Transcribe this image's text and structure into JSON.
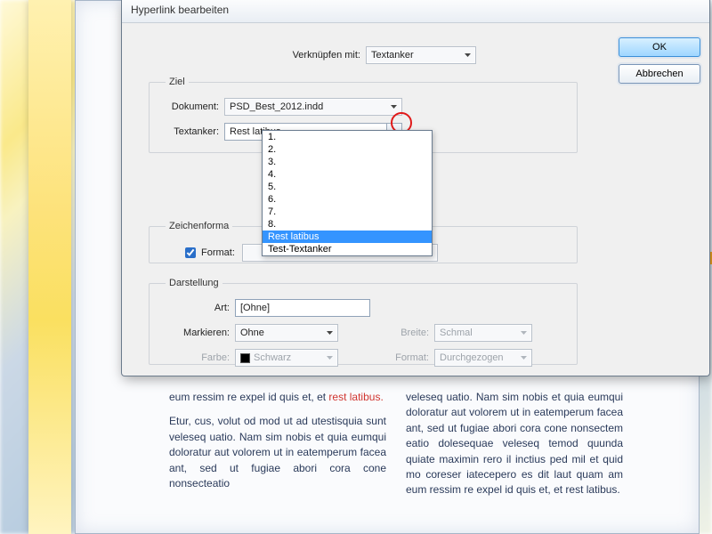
{
  "dialog": {
    "title": "Hyperlink bearbeiten",
    "link_with_label": "Verknüpfen mit:",
    "link_with_value": "Textanker",
    "ok": "OK",
    "cancel": "Abbrechen"
  },
  "ziel": {
    "legend": "Ziel",
    "document_label": "Dokument:",
    "document_value": "PSD_Best_2012.indd",
    "anchor_label": "Textanker:",
    "anchor_value": "Rest latibus",
    "options": [
      "1.",
      "2.",
      "3.",
      "4.",
      "5.",
      "6.",
      "7.",
      "8.",
      "Rest latibus",
      "Test-Textanker"
    ],
    "selected_index": 8
  },
  "zf": {
    "legend": "Zeichenforma",
    "format_label": "Format:",
    "format_value": ""
  },
  "dar": {
    "legend": "Darstellung",
    "art_label": "Art:",
    "art_value": "[Ohne]",
    "mark_label": "Markieren:",
    "mark_value": "Ohne",
    "breite_label": "Breite:",
    "breite_value": "Schmal",
    "color_label": "Farbe:",
    "color_value": "Schwarz",
    "style_label": "Format:",
    "style_value": "Durchgezogen"
  },
  "doc": {
    "p1a": "eum ressim re expel id quis et, et ",
    "p1red": "rest latibus.",
    "p2": "Etur, cus, volut od mod ut ad utestisquia sunt veleseq uatio. Nam sim nobis et quia eumqui doloratur aut volorem ut in eatemperum facea ant, sed ut fugiae abori cora cone nonsecteatio",
    "p3": "veleseq uatio. Nam sim nobis et quia eumqui doloratur aut volorem ut in eatemperum facea ant, sed ut fugiae abori cora cone nonsectem eatio dolesequae veleseq temod quunda quiate maximin rero il inctius ped mil et quid mo coreser iatecepero es dit laut quam am eum ressim re expel id quis et, et rest latibus."
  }
}
